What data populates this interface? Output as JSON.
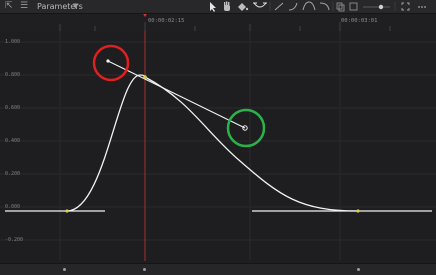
{
  "toolbar": {
    "title": "Parameters",
    "chevron_icon": "chevron-down-icon",
    "tools": [
      "pointer-icon",
      "hand-icon",
      "fill-icon",
      "curve-tool-icon",
      "linear-icon",
      "ease-in-icon",
      "ease-icon",
      "ease-out-icon",
      "copy-icon",
      "paste-icon",
      "zoom-slider",
      "fit-icon",
      "more-icon"
    ]
  },
  "ruler": {
    "timecodes": [
      "00:00:02:15",
      "00:00:03:01"
    ]
  },
  "graph": {
    "y_labels": [
      "1.000",
      "0.800",
      "0.600",
      "0.400",
      "0.200",
      "0.000",
      "-0.200"
    ],
    "colors": {
      "playhead": "#c0392b",
      "curve": "#ffffff",
      "red_circle": "#e02020",
      "green_circle": "#2bb34a",
      "keyframe": "#d7d04a"
    }
  },
  "bottombar": {
    "markers": 3
  }
}
